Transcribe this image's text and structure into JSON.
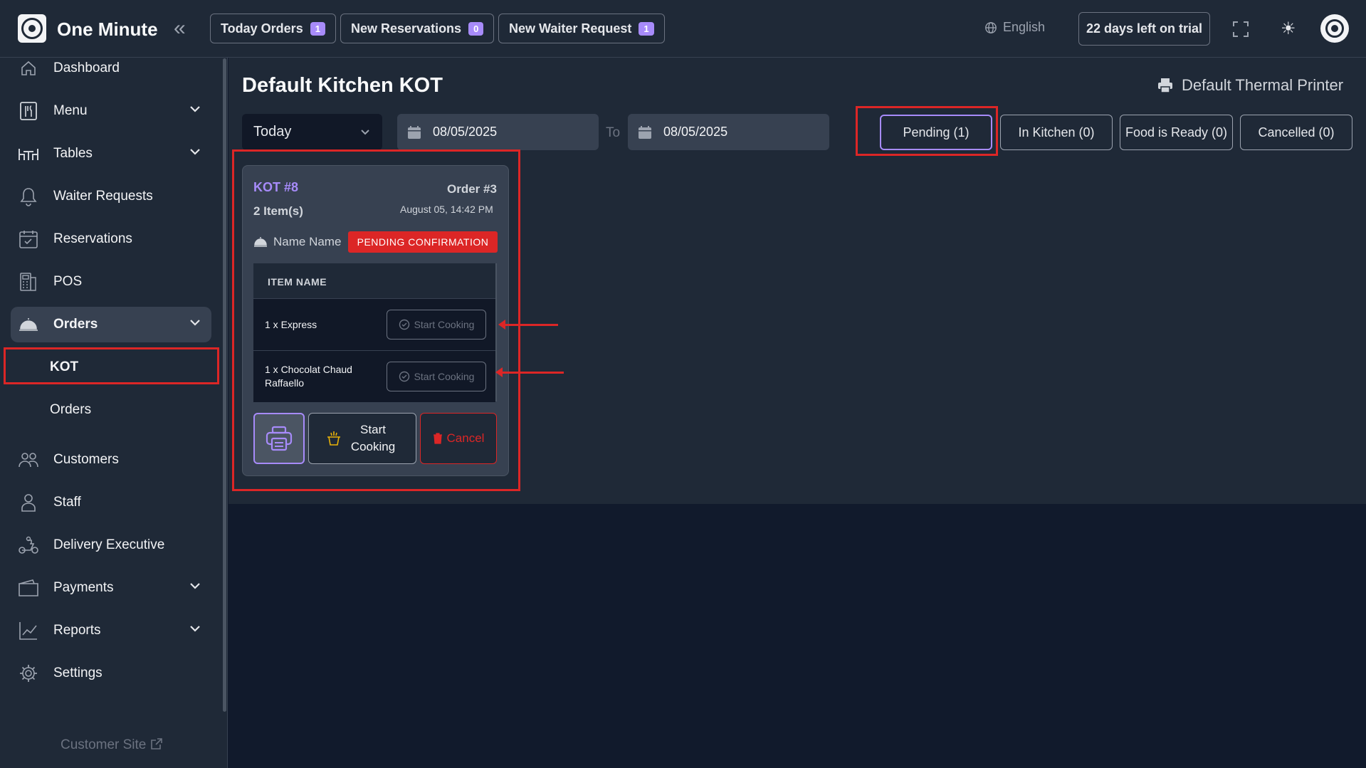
{
  "app": {
    "title": "One Minute"
  },
  "topbar": {
    "buttons": [
      {
        "label": "Today Orders",
        "count": "1"
      },
      {
        "label": "New Reservations",
        "count": "0"
      },
      {
        "label": "New Waiter Request",
        "count": "1"
      }
    ],
    "language": "English",
    "trial": "22 days left on trial"
  },
  "sidebar": {
    "items": [
      {
        "label": "Dashboard",
        "icon": "home-icon"
      },
      {
        "label": "Menu",
        "icon": "menu-book-icon"
      },
      {
        "label": "Tables",
        "icon": "table-icon"
      },
      {
        "label": "Waiter Requests",
        "icon": "bell-icon"
      },
      {
        "label": "Reservations",
        "icon": "calendar-check-icon"
      },
      {
        "label": "POS",
        "icon": "pos-icon"
      },
      {
        "label": "Orders",
        "icon": "cloche-icon"
      },
      {
        "label": "Customers",
        "icon": "users-icon"
      },
      {
        "label": "Staff",
        "icon": "user-icon"
      },
      {
        "label": "Delivery Executive",
        "icon": "scooter-icon"
      },
      {
        "label": "Payments",
        "icon": "wallet-icon"
      },
      {
        "label": "Reports",
        "icon": "chart-icon"
      },
      {
        "label": "Settings",
        "icon": "gear-icon"
      }
    ],
    "orders_sub": [
      "KOT",
      "Orders"
    ],
    "customer_site": "Customer Site"
  },
  "page": {
    "title": "Default Kitchen KOT",
    "printer": "Default Thermal Printer"
  },
  "filters": {
    "period": "Today",
    "date_from": "08/05/2025",
    "to_label": "To",
    "date_to": "08/05/2025",
    "status_tabs": [
      "Pending (1)",
      "In Kitchen (0)",
      "Food is Ready (0)",
      "Cancelled (0)"
    ],
    "active_tab": "Pending (1)"
  },
  "kot": {
    "number": "KOT #8",
    "order": "Order #3",
    "items_count": "2 Item(s)",
    "timestamp": "August 05, 14:42 PM",
    "customer": "Name Name",
    "status": "PENDING CONFIRMATION",
    "table_header": "ITEM NAME",
    "items": [
      {
        "name": "1 x Express",
        "action": "Start Cooking"
      },
      {
        "name": "1 x Chocolat Chaud Raffaello",
        "action": "Start Cooking"
      }
    ],
    "actions": {
      "start": "Start Cooking",
      "cancel": "Cancel"
    }
  },
  "colors": {
    "accent": "#a78bfa",
    "danger": "#dc2626",
    "surface": "#1f2937",
    "background": "#111a2c"
  }
}
